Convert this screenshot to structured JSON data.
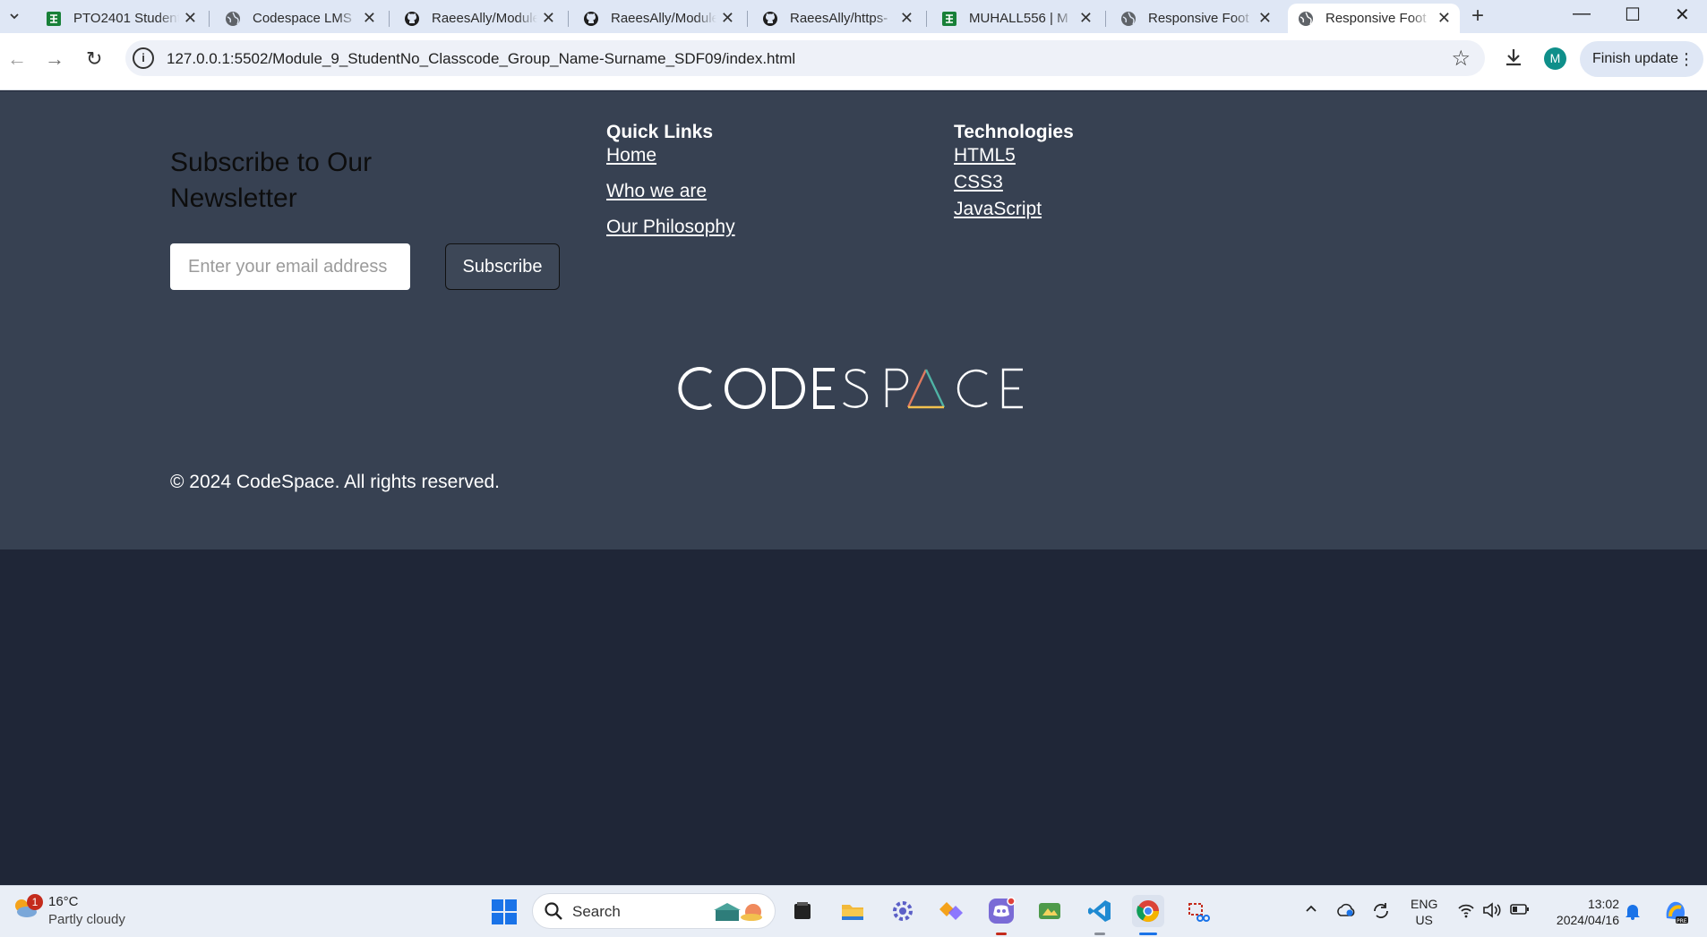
{
  "browser": {
    "tabs": [
      {
        "title": "PTO2401 Student",
        "favicon": "sheets-icon",
        "active": false
      },
      {
        "title": "Codespace LMS",
        "favicon": "globe-icon",
        "active": false
      },
      {
        "title": "RaeesAlly/Module",
        "favicon": "github-icon",
        "active": false
      },
      {
        "title": "RaeesAlly/Module",
        "favicon": "github-icon",
        "active": false
      },
      {
        "title": "RaeesAlly/https-",
        "favicon": "github-icon",
        "active": false
      },
      {
        "title": "MUHALL556 | M",
        "favicon": "sheets-icon",
        "active": false
      },
      {
        "title": "Responsive Foot",
        "favicon": "globe-icon",
        "active": false
      },
      {
        "title": "Responsive Foot",
        "favicon": "globe-icon",
        "active": true
      }
    ],
    "url": "127.0.0.1:5502/Module_9_StudentNo_Classcode_Group_Name-Surname_SDF09/index.html",
    "profile_initial": "M",
    "finish_update_label": "Finish update"
  },
  "footer": {
    "newsletter_title": "Subscribe to Our Newsletter",
    "email_placeholder": "Enter your email address",
    "subscribe_label": "Subscribe",
    "quick_links": {
      "title": "Quick Links",
      "items": [
        "Home",
        "Who we are",
        "Our Philosophy"
      ]
    },
    "technologies": {
      "title": "Technologies",
      "items": [
        "HTML5",
        "CSS3",
        "JavaScript"
      ]
    },
    "logo_text": "CODESPACE",
    "copyright": "© 2024 CodeSpace. All rights reserved."
  },
  "taskbar": {
    "weather_temp": "16°C",
    "weather_desc": "Partly cloudy",
    "weather_badge": "1",
    "search_label": "Search",
    "lang_line1": "ENG",
    "lang_line2": "US",
    "time": "13:02",
    "date": "2024/04/16"
  },
  "colors": {
    "footer_bg": "#374152",
    "page_bg": "#1f2637",
    "tabstrip_bg": "#dfe7f5"
  }
}
